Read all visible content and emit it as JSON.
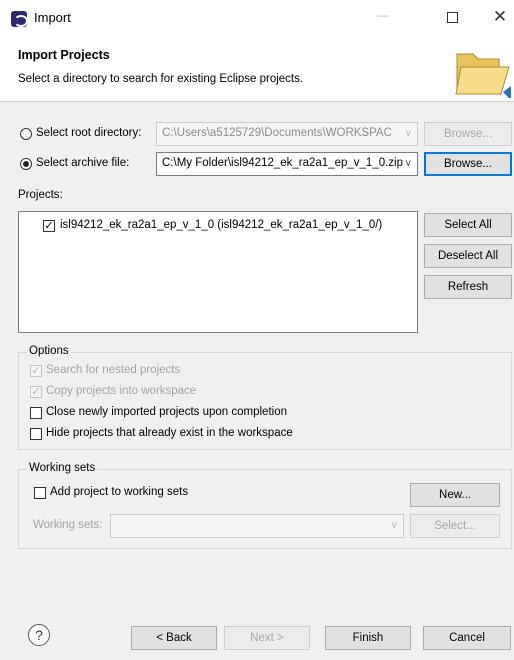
{
  "window": {
    "title": "Import",
    "controls": {
      "minimize": "—",
      "close": "✕"
    }
  },
  "header": {
    "title": "Import Projects",
    "description": "Select a directory to search for existing Eclipse projects.",
    "icon": "folder-icon"
  },
  "source": {
    "root_directory": {
      "label": "Select root directory:",
      "selected": false,
      "value": "C:\\Users\\a5125729\\Documents\\WORKSPAC",
      "browse_label": "Browse..."
    },
    "archive_file": {
      "label": "Select archive file:",
      "selected": true,
      "value": "C:\\My Folder\\isl94212_ek_ra2a1_ep_v_1_0.zip",
      "browse_label": "Browse..."
    },
    "combo_chevron": "∨"
  },
  "projects": {
    "label": "Projects:",
    "items": [
      {
        "checked": true,
        "check_mark": "✓",
        "label": "isl94212_ek_ra2a1_ep_v_1_0 (isl94212_ek_ra2a1_ep_v_1_0/)"
      }
    ],
    "buttons": {
      "select_all": "Select All",
      "deselect_all": "Deselect All",
      "refresh": "Refresh"
    }
  },
  "options": {
    "legend": "Options",
    "search_nested": {
      "label": "Search for nested projects",
      "checked": true,
      "enabled": false,
      "check_mark": "✓"
    },
    "copy_into_workspace": {
      "label": "Copy projects into workspace",
      "checked": true,
      "enabled": false,
      "check_mark": "✓"
    },
    "close_imported": {
      "label": "Close newly imported projects upon completion",
      "checked": false,
      "enabled": true
    },
    "hide_existing": {
      "label": "Hide projects that already exist in the workspace",
      "checked": false,
      "enabled": true
    }
  },
  "working_sets": {
    "legend": "Working sets",
    "add_to_working_sets": {
      "label": "Add project to working sets",
      "checked": false
    },
    "new_label": "New...",
    "working_sets_label": "Working sets:",
    "working_sets_value": "",
    "select_label": "Select..."
  },
  "footer": {
    "help_glyph": "?",
    "back_label": "< Back",
    "next_label": "Next >",
    "finish_label": "Finish",
    "cancel_label": "Cancel"
  },
  "colors": {
    "dialog_bg": "#f0f0f0",
    "header_bg": "#ffffff",
    "focus_border": "#0078d7",
    "button_bg": "#e1e1e1"
  }
}
